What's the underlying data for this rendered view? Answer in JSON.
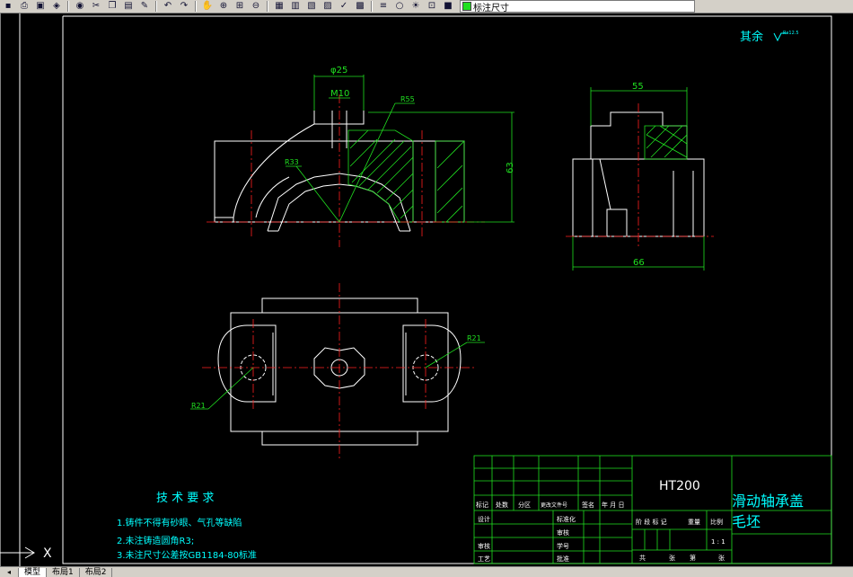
{
  "toolbar": {
    "layer_name": "标注尺寸",
    "buttons": [
      "save-icon",
      "print-icon",
      "preview-icon",
      "publish-icon",
      "plot-icon",
      "cut-icon",
      "copy-icon",
      "paste-icon",
      "match-icon",
      "undo-icon",
      "redo-icon",
      "pan-icon",
      "zoom-realtime-icon",
      "zoom-window-icon",
      "zoom-previous-icon",
      "properties-icon",
      "design-center-icon",
      "tool-palette-icon",
      "sheet-set-icon",
      "markup-icon",
      "calc-icon",
      "layer-manager-icon",
      "bulb-icon",
      "sun-icon",
      "lock-icon",
      "color-icon"
    ]
  },
  "drawing": {
    "surface_note": "其余",
    "surface_symbol": "Ra12.5",
    "dimensions": {
      "phi25": "φ25",
      "m10": "M10",
      "r55": "R55",
      "r33": "R33",
      "d63": "63",
      "d55": "55",
      "d66": "66",
      "r21_left": "R21",
      "r21_right": "R21"
    },
    "tech_requirements": {
      "title": "技 术 要 求",
      "items": [
        "1.铸件不得有砂眼、气孔等缺陷",
        "2.未注铸造圆角R3;",
        "3.未注尺寸公差按GB1184-80标准"
      ]
    },
    "title_block": {
      "material": "HT200",
      "part_name": "滑动轴承盖",
      "part_type": "毛坯",
      "row_labels": [
        "标记",
        "处数",
        "分区",
        "更改文件号",
        "签名",
        "年 月 日"
      ],
      "left_labels": [
        "设计",
        "审核",
        "工艺"
      ],
      "mid_labels": [
        "标准化",
        "审核",
        "学号",
        "批准"
      ],
      "stage_labels": [
        "阶 段 标 记",
        "重量",
        "比例"
      ],
      "scale": "1 : 1",
      "sheet_labels": [
        "共",
        "张",
        "第",
        "张"
      ]
    },
    "ucs_label": "X"
  },
  "tabs": [
    "模型",
    "布局1",
    "布局2"
  ],
  "colors": {
    "geometry": "#ffffff",
    "center": "#ff2020",
    "dimension": "#20e020",
    "hatch": "#20e020",
    "text": "#00ffff",
    "border": "#ffffff"
  }
}
